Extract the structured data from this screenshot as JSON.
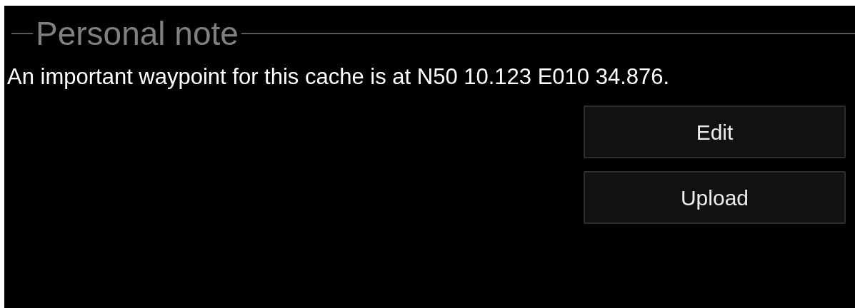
{
  "section": {
    "title": "Personal note"
  },
  "note": {
    "text": "An important waypoint for this cache is at N50 10.123 E010 34.876."
  },
  "buttons": [
    {
      "label": "Edit"
    },
    {
      "label": "Upload"
    }
  ]
}
